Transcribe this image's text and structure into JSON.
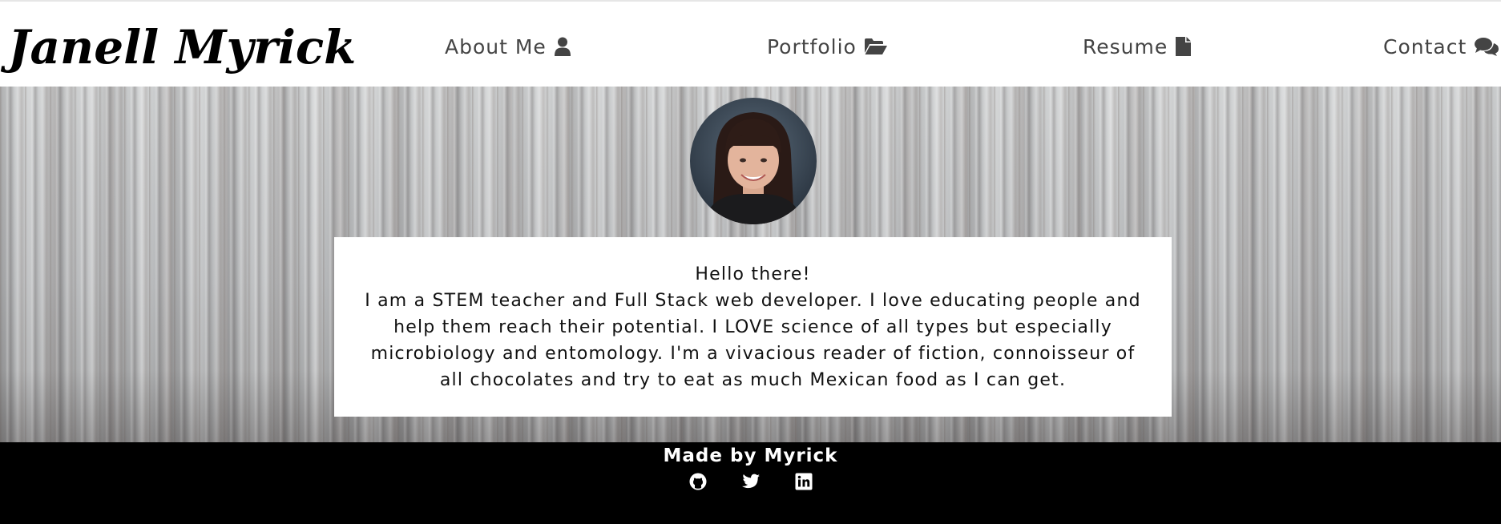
{
  "header": {
    "brand": "Janell Myrick",
    "nav": [
      {
        "label": "About Me",
        "icon": "user-icon"
      },
      {
        "label": "Portfolio",
        "icon": "folder-open-icon"
      },
      {
        "label": "Resume",
        "icon": "file-icon"
      },
      {
        "label": "Contact",
        "icon": "comments-icon"
      }
    ]
  },
  "hero": {
    "greeting": "Hello there!",
    "bio": "I am a STEM teacher and Full Stack web developer. I love educating people and help them reach their potential. I LOVE science of all types but especially microbiology and entomology. I'm a vivacious reader of fiction, connoisseur of all chocolates and try to eat as much Mexican food as I can get."
  },
  "footer": {
    "made_by": "Made by Myrick",
    "social": [
      "github-icon",
      "twitter-icon",
      "linkedin-icon"
    ]
  },
  "colors": {
    "nav_text": "#444444",
    "footer_bg": "#000000",
    "card_bg": "#ffffff"
  }
}
